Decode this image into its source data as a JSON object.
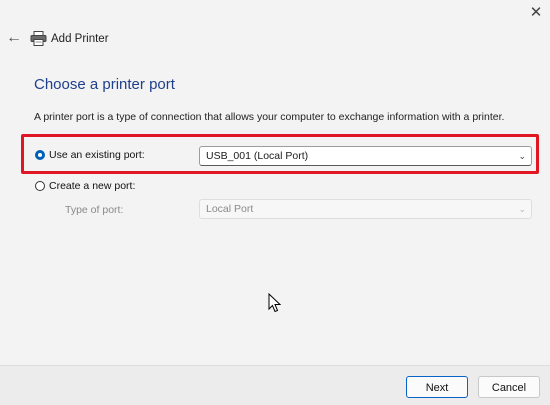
{
  "window": {
    "title": "Add Printer",
    "close_glyph": "✕",
    "back_glyph": "←"
  },
  "page": {
    "heading": "Choose a printer port",
    "description": "A printer port is a type of connection that allows your computer to exchange information with a printer."
  },
  "options": {
    "existing": {
      "label": "Use an existing port:",
      "selected": true,
      "value": "USB_001 (Local Port)"
    },
    "new": {
      "label": "Create a new port:",
      "selected": false,
      "type_label": "Type of port:",
      "type_value": "Local Port"
    }
  },
  "buttons": {
    "next": "Next",
    "cancel": "Cancel"
  },
  "icons": {
    "chevron": "⌄"
  },
  "colors": {
    "accent": "#005fb8",
    "highlight": "#e01722",
    "heading": "#1f3f8c"
  }
}
